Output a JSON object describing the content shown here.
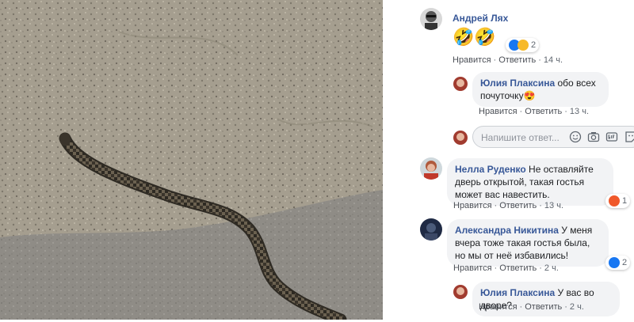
{
  "photo": {
    "description_icon": "snake-photo"
  },
  "comments": [
    {
      "author": "Андрей Лях",
      "text": "🤣🤣",
      "like": "Нравится",
      "reply": "Ответить",
      "time": "14 ч.",
      "reaction_count": "2"
    },
    {
      "author": "Юлия Плаксина",
      "text": "обо всех почуточку😍",
      "like": "Нравится",
      "reply": "Ответить",
      "time": "13 ч."
    },
    {
      "author": "Нелла Руденко",
      "text": "Не оставляйте дверь открытой, такая гостья может вас навестить.",
      "like": "Нравится",
      "reply": "Ответить",
      "time": "13 ч.",
      "reaction_count": "1"
    },
    {
      "author": "Александра Никитина",
      "text": "У меня вчера тоже такая гостья была, но мы от неё избавились!",
      "like": "Нравится",
      "reply": "Ответить",
      "time": "2 ч.",
      "reaction_count": "2"
    },
    {
      "author": "Юлия Плаксина",
      "text": "У вас во дворе?",
      "like": "Нравится",
      "reply": "Ответить",
      "time": "2 ч."
    }
  ],
  "reply_input": {
    "placeholder": "Напишите ответ..."
  },
  "colors": {
    "link": "#385898",
    "bubble": "#f2f3f5",
    "like_blue": "#1877f2",
    "angry_orange": "#f0582a"
  }
}
